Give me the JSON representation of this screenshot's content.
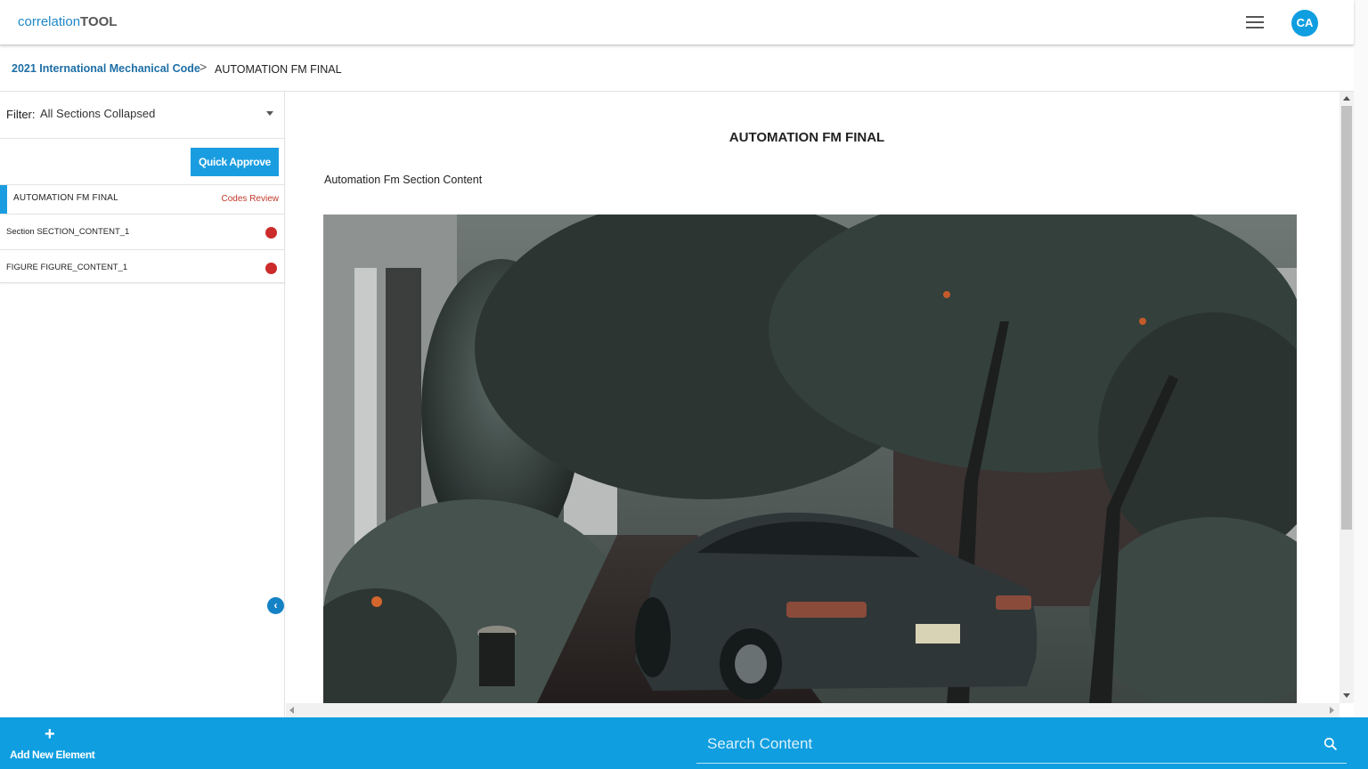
{
  "app": {
    "logo_prefix": "correlation",
    "logo_suffix": "TOOL",
    "avatar_initials": "CA"
  },
  "breadcrumb": {
    "parent": "2021 International Mechanical Code",
    "separator": ">",
    "current": "AUTOMATION FM FINAL"
  },
  "sidebar": {
    "filter_label": "Filter:",
    "filter_value": "All Sections Collapsed",
    "quick_approve_label": "Quick Approve",
    "items": [
      {
        "label": "AUTOMATION FM FINAL",
        "status": "Codes Review"
      },
      {
        "label": "Section SECTION_CONTENT_1",
        "status_color": "#cc2b2b"
      },
      {
        "label": "FIGURE FIGURE_CONTENT_1",
        "status_color": "#cc2b2b"
      }
    ],
    "collapse_icon": "chevron-left-icon"
  },
  "content": {
    "title": "AUTOMATION FM FINAL",
    "section_text": "Automation Fm Section Content",
    "figure": "photo-car-in-garden"
  },
  "bottombar": {
    "add_icon": "+",
    "add_label": "Add New Element",
    "search_placeholder": "Search Content"
  },
  "colors": {
    "accent": "#0f9ee0",
    "link": "#1d6ea6",
    "status_red": "#cc2b2b"
  }
}
